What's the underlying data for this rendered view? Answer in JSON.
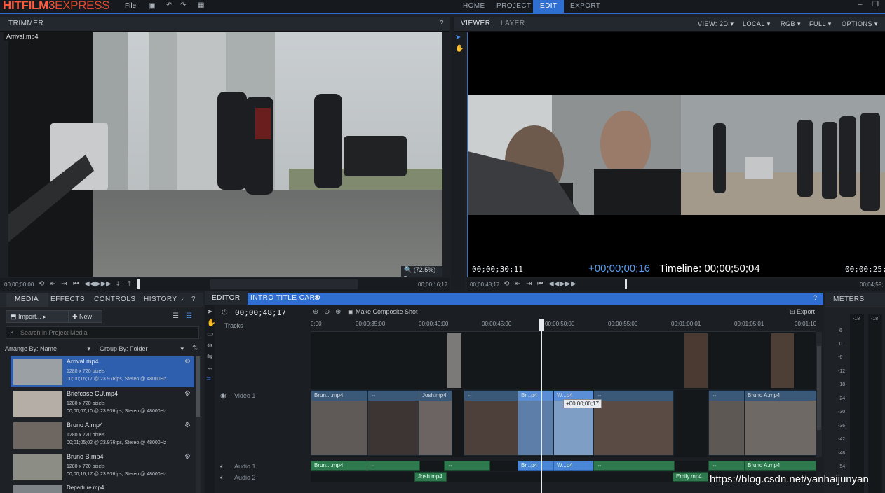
{
  "app": {
    "logo_part1": "HITFILM",
    "logo_part2": "3",
    "logo_part3": "EXPRESS",
    "file_menu": "File",
    "nav_tabs": [
      "HOME",
      "PROJECT",
      "EDIT",
      "EXPORT"
    ]
  },
  "trimmer": {
    "title": "TRIMMER",
    "clip_label": "Arrival.mp4",
    "zoom_label": "(72.5%)",
    "timecode_left": "00;00;00;00",
    "timecode_right": "00;00;16;17"
  },
  "viewer": {
    "tabs": [
      "VIEWER",
      "LAYER"
    ],
    "options": [
      "VIEW: 2D",
      "LOCAL",
      "RGB",
      "FULL",
      "OPTIONS"
    ],
    "tc_left": "00;00;30;11",
    "tc_offset": "+00;00;00;16",
    "tc_timeline": "Timeline: 00;00;50;04",
    "tc_right": "00;00;25;0",
    "bottom_left": "00;00;48;17",
    "bottom_right": "00;04;59;"
  },
  "media_panel": {
    "tabs": [
      "MEDIA",
      "EFFECTS",
      "CONTROLS",
      "HISTORY"
    ],
    "import_label": "Import...",
    "new_label": "New",
    "search_placeholder": "Search in Project Media",
    "arrange_label": "Arrange By: Name",
    "group_label": "Group By: Folder",
    "items": [
      {
        "name": "Arrival.mp4",
        "res": "1280 x 720 pixels",
        "meta": "00;00;16;17 @ 23.976fps, Stereo @ 48000Hz"
      },
      {
        "name": "Briefcase CU.mp4",
        "res": "1280 x 720 pixels",
        "meta": "00;00;07;10 @ 23.976fps, Stereo @ 48000Hz"
      },
      {
        "name": "Bruno A.mp4",
        "res": "1280 x 720 pixels",
        "meta": "00;01;05;02 @ 23.976fps, Stereo @ 48000Hz"
      },
      {
        "name": "Bruno B.mp4",
        "res": "1280 x 720 pixels",
        "meta": "00;00;16;17 @ 23.976fps, Stereo @ 48000Hz"
      },
      {
        "name": "Departure.mp4",
        "res": "",
        "meta": ""
      }
    ]
  },
  "editor": {
    "tabs": [
      "EDITOR",
      "INTRO TITLE CARD"
    ],
    "timecode": "00;00;48;17",
    "composite_label": "Make Composite Shot",
    "export_label": "Export",
    "tracks_label": "Tracks",
    "ruler": [
      "0;00",
      "00;00;35;00",
      "00;00;40;00",
      "00;00;45;00",
      "00;00;50;00",
      "00;00;55;00",
      "00;01;00;01",
      "00;01;05;01",
      "00;01;10"
    ],
    "track_video1": "Video 1",
    "track_audio1": "Audio 1",
    "track_audio2": "Audio 2",
    "tooltip": "+00;00;00;17",
    "video_clips": [
      "Brun....mp4",
      "Josh.mp4",
      "Br...p4",
      "W...p4",
      "Bruno A.mp4"
    ],
    "audio1_clips": [
      "Brun....mp4",
      "Br...p4",
      "W...p4",
      "Bruno A.mp4"
    ],
    "audio2_clips": [
      "Josh.mp4",
      "Emily.mp4"
    ]
  },
  "meters": {
    "title": "METERS",
    "channel_labels": [
      "-18",
      "-18"
    ],
    "scale": [
      "6",
      "0",
      "-6",
      "-12",
      "-18",
      "-24",
      "-30",
      "-36",
      "-42",
      "-48",
      "-54"
    ]
  },
  "watermark": "https://blog.csdn.net/yanhaijunyan"
}
